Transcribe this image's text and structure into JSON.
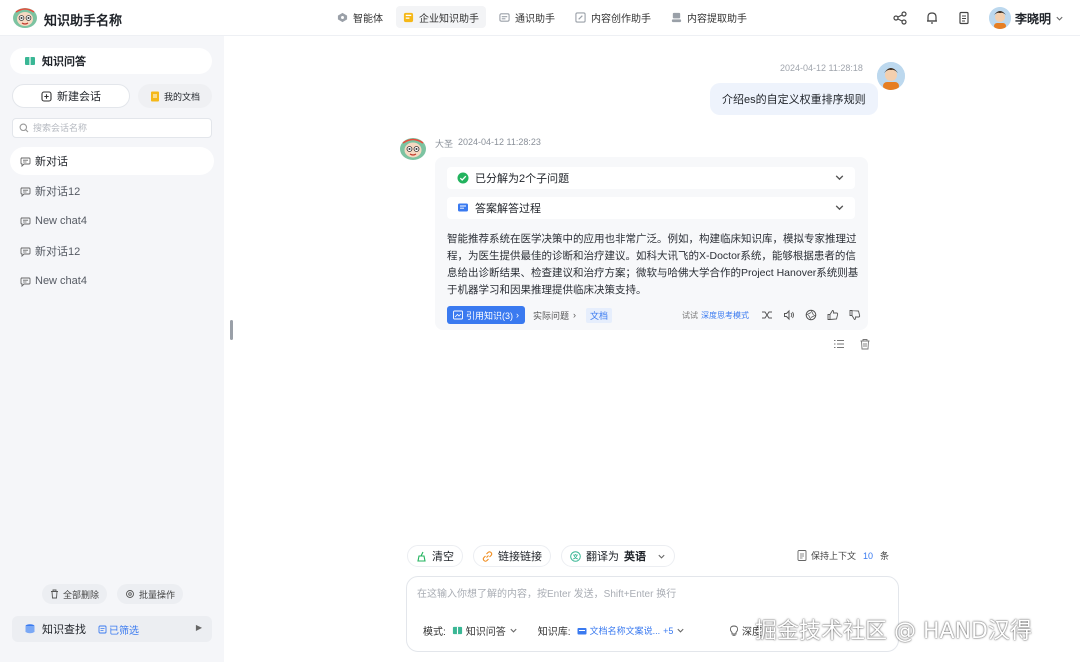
{
  "app": {
    "title": "知识助手名称"
  },
  "nav": [
    {
      "label": "智能体",
      "icon": "agent-icon",
      "active": false
    },
    {
      "label": "企业知识助手",
      "icon": "enterprise-knowledge-icon",
      "active": true
    },
    {
      "label": "通识助手",
      "icon": "general-assistant-icon",
      "active": false
    },
    {
      "label": "内容创作助手",
      "icon": "content-creation-icon",
      "active": false
    },
    {
      "label": "内容提取助手",
      "icon": "content-extraction-icon",
      "active": false
    }
  ],
  "user": {
    "name": "李晓明"
  },
  "sidebar": {
    "mode_title": "知识问答",
    "new_chat_label": "新建会话",
    "my_docs_label": "我的文档",
    "search_placeholder": "搜索会话名称",
    "conversations": [
      {
        "label": "新对话",
        "active": true
      },
      {
        "label": "新对话12",
        "active": false
      },
      {
        "label": "New chat4",
        "active": false
      },
      {
        "label": "新对话12",
        "active": false
      },
      {
        "label": "New chat4",
        "active": false
      }
    ],
    "delete_all_label": "全部删除",
    "batch_label": "批量操作",
    "kb_search_label": "知识查找",
    "filtered_label": "已筛选"
  },
  "chat": {
    "user_time": "2024-04-12 11:28:18",
    "user_message": "介绍es的自定义权重排序规则",
    "bot_name": "大圣",
    "bot_time": "2024-04-12 11:28:23",
    "step1": "已分解为2个子问题",
    "step2": "答案解答过程",
    "answer": "智能推荐系统在医学决策中的应用也非常广泛。例如，构建临床知识库，模拟专家推理过程，为医生提供最佳的诊断和治疗建议。如科大讯飞的X-Doctor系统，能够根据患者的信息给出诊断结果、检查建议和治疗方案；微软与哈佛大学合作的Project Hanover系统则基于机器学习和因果推理提供临床决策支持。",
    "cite_label": "引用知识(3)",
    "actual_q_label": "实际问题",
    "doc_label": "文档",
    "try_label": "试试",
    "deep_mode_label": "深度思考模式"
  },
  "input": {
    "clear_label": "清空",
    "link_label": "链接链接",
    "translate_label": "翻译为",
    "translate_lang": "英语",
    "keep_ctx_label": "保持上下文",
    "keep_ctx_count": "10",
    "keep_ctx_unit": "条",
    "placeholder": "在这输入你想了解的内容，按Enter 发送，Shift+Enter 换行",
    "mode_label": "模式:",
    "mode_value": "知识问答",
    "kb_label": "知识库:",
    "kb_value": "文档名称文案说...",
    "kb_more": "+5",
    "deep_label": "深度"
  },
  "watermark": "掘金技术社区 @ HAND汉得",
  "colors": {
    "accent": "#3a7af0",
    "sidebar_bg": "#f5f6f9",
    "bubble_user": "#eef3fc",
    "card_bg": "#f7f8fa",
    "success": "#22b35e"
  }
}
